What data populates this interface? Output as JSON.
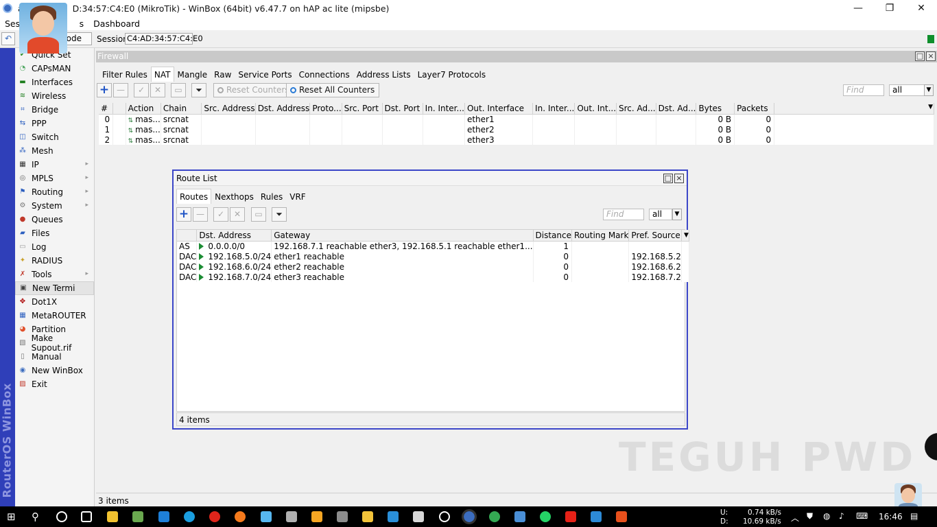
{
  "window": {
    "title": "admin@C4:AD:34:57:C4:E0 (MikroTik) - WinBox (64bit) v6.47.7 on hAP ac lite (mipsbe)",
    "title_visible": "a",
    "title_visible_rest": "D:34:57:C4:E0 (MikroTik) - WinBox (64bit) v6.47.7 on hAP ac lite (mipsbe)"
  },
  "menubar": {
    "session": "Sess",
    "settings_tail": "s",
    "dashboard": "Dashboard"
  },
  "toolbar": {
    "mode": "lode",
    "session_label": "Session:",
    "session_value": "C4:AD:34:57:C4:E0"
  },
  "brand": "RouterOS WinBox",
  "sidebar": {
    "items": [
      {
        "label": "Quick Set",
        "icon": "quickset-icon",
        "sub": false
      },
      {
        "label": "CAPsMAN",
        "icon": "capsman-icon",
        "sub": false
      },
      {
        "label": "Interfaces",
        "icon": "interfaces-icon",
        "sub": false
      },
      {
        "label": "Wireless",
        "icon": "wireless-icon",
        "sub": false
      },
      {
        "label": "Bridge",
        "icon": "bridge-icon",
        "sub": false
      },
      {
        "label": "PPP",
        "icon": "ppp-icon",
        "sub": false
      },
      {
        "label": "Switch",
        "icon": "switch-icon",
        "sub": false
      },
      {
        "label": "Mesh",
        "icon": "mesh-icon",
        "sub": false
      },
      {
        "label": "IP",
        "icon": "ip-icon",
        "sub": true
      },
      {
        "label": "MPLS",
        "icon": "mpls-icon",
        "sub": true
      },
      {
        "label": "Routing",
        "icon": "routing-icon",
        "sub": true
      },
      {
        "label": "System",
        "icon": "system-icon",
        "sub": true
      },
      {
        "label": "Queues",
        "icon": "queues-icon",
        "sub": false
      },
      {
        "label": "Files",
        "icon": "files-icon",
        "sub": false
      },
      {
        "label": "Log",
        "icon": "log-icon",
        "sub": false
      },
      {
        "label": "RADIUS",
        "icon": "radius-icon",
        "sub": false
      },
      {
        "label": "Tools",
        "icon": "tools-icon",
        "sub": true
      },
      {
        "label": "New Termi",
        "icon": "terminal-icon",
        "sub": false
      },
      {
        "label": "Dot1X",
        "icon": "dot1x-icon",
        "sub": false
      },
      {
        "label": "MetaROUTER",
        "icon": "metarouter-icon",
        "sub": false
      },
      {
        "label": "Partition",
        "icon": "partition-icon",
        "sub": false
      },
      {
        "label": "Make Supout.rif",
        "icon": "supout-icon",
        "sub": false
      },
      {
        "label": "Manual",
        "icon": "manual-icon",
        "sub": false
      },
      {
        "label": "New WinBox",
        "icon": "winbox-icon",
        "sub": false
      },
      {
        "label": "Exit",
        "icon": "exit-icon",
        "sub": false
      }
    ]
  },
  "firewall": {
    "title": "Firewall",
    "tabs": [
      "Filter Rules",
      "NAT",
      "Mangle",
      "Raw",
      "Service Ports",
      "Connections",
      "Address Lists",
      "Layer7 Protocols"
    ],
    "reset_counters": "Reset Counters",
    "reset_all_counters": "Reset All Counters",
    "find_placeholder": "Find",
    "filter_value": "all",
    "columns": [
      "#",
      "Action",
      "Chain",
      "Src. Address",
      "Dst. Address",
      "Proto...",
      "Src. Port",
      "Dst. Port",
      "In. Inter...",
      "Out. Interface",
      "In. Inter...",
      "Out. Int...",
      "Src. Ad...",
      "Dst. Ad...",
      "Bytes",
      "Packets"
    ],
    "rows": [
      {
        "num": "0",
        "action": "mas...",
        "chain": "srcnat",
        "out_if": "ether1",
        "bytes": "0 B",
        "packets": "0"
      },
      {
        "num": "1",
        "action": "mas...",
        "chain": "srcnat",
        "out_if": "ether2",
        "bytes": "0 B",
        "packets": "0"
      },
      {
        "num": "2",
        "action": "mas...",
        "chain": "srcnat",
        "out_if": "ether3",
        "bytes": "0 B",
        "packets": "0"
      }
    ],
    "status": "3 items"
  },
  "route_list": {
    "title": "Route List",
    "tabs": [
      "Routes",
      "Nexthops",
      "Rules",
      "VRF"
    ],
    "find_placeholder": "Find",
    "filter_value": "all",
    "columns": [
      "",
      "Dst. Address",
      "Gateway",
      "Distance",
      "Routing Mark",
      "Pref. Source"
    ],
    "rows": [
      {
        "flags": "AS",
        "dst": "0.0.0.0/0",
        "gateway": "192.168.7.1 reachable ether3, 192.168.5.1 reachable ether1...",
        "distance": "1",
        "mark": "",
        "pref": ""
      },
      {
        "flags": "DAC",
        "dst": "192.168.5.0/24",
        "gateway": "ether1 reachable",
        "distance": "0",
        "mark": "",
        "pref": "192.168.5.2"
      },
      {
        "flags": "DAC",
        "dst": "192.168.6.0/24",
        "gateway": "ether2 reachable",
        "distance": "0",
        "mark": "",
        "pref": "192.168.6.2"
      },
      {
        "flags": "DAC",
        "dst": "192.168.7.0/24",
        "gateway": "ether3 reachable",
        "distance": "0",
        "mark": "",
        "pref": "192.168.7.2"
      }
    ],
    "status": "4 items"
  },
  "watermark": "TEGUH PWD",
  "taskbar": {
    "net_up_label": "U:",
    "net_up": "0.74 kB/s",
    "net_down_label": "D:",
    "net_down": "10.69 kB/s",
    "time": "16:46"
  }
}
